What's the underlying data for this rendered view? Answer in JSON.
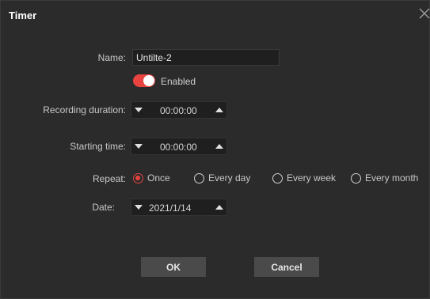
{
  "dialog": {
    "title": "Timer"
  },
  "form": {
    "name_label": "Name:",
    "name_value": "Untilte-2",
    "enabled_label": "Enabled",
    "enabled": true,
    "duration_label": "Recording duration:",
    "duration_value": "00:00:00",
    "start_label": "Starting time:",
    "start_value": "00:00:00",
    "repeat_label": "Repeat:",
    "repeat_options": [
      {
        "label": "Once",
        "checked": true
      },
      {
        "label": "Every day",
        "checked": false
      },
      {
        "label": "Every week",
        "checked": false
      },
      {
        "label": "Every month",
        "checked": false
      }
    ],
    "date_label": "Date:",
    "date_value": "2021/1/14"
  },
  "buttons": {
    "ok": "OK",
    "cancel": "Cancel"
  },
  "colors": {
    "accent": "#e8433f",
    "background": "#2b2b2b",
    "field": "#1f1f1f",
    "button": "#4a4a4a"
  },
  "icons": {
    "close": "close-icon",
    "down": "triangle-down-icon",
    "up": "triangle-up-icon"
  }
}
